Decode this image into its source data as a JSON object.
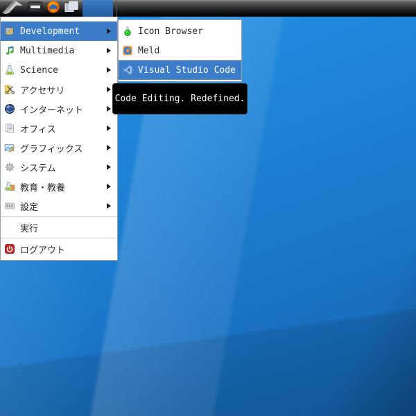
{
  "panel": {
    "buttons": [
      {
        "icon": "app-menu-logo-icon"
      },
      {
        "icon": "file-manager-icon"
      },
      {
        "icon": "firefox-icon"
      },
      {
        "icon": "window-pager-icon"
      },
      {
        "icon": "active-task-button",
        "active": true,
        "color": "#2a65ad"
      }
    ]
  },
  "menu": {
    "items": [
      {
        "label": "Development",
        "icon": "development-icon",
        "has_submenu": true,
        "highlighted": true
      },
      {
        "label": "Multimedia",
        "icon": "multimedia-icon",
        "has_submenu": true,
        "highlighted": false
      },
      {
        "label": "Science",
        "icon": "science-icon",
        "has_submenu": true,
        "highlighted": false
      },
      {
        "label": "アクセサリ",
        "icon": "accessories-icon",
        "has_submenu": true,
        "highlighted": false
      },
      {
        "label": "インターネット",
        "icon": "internet-icon",
        "has_submenu": true,
        "highlighted": false
      },
      {
        "label": "オフィス",
        "icon": "office-icon",
        "has_submenu": true,
        "highlighted": false
      },
      {
        "label": "グラフィックス",
        "icon": "graphics-icon",
        "has_submenu": true,
        "highlighted": false
      },
      {
        "label": "システム",
        "icon": "system-icon",
        "has_submenu": true,
        "highlighted": false
      },
      {
        "label": "教育・教養",
        "icon": "education-icon",
        "has_submenu": true,
        "highlighted": false
      },
      {
        "label": "設定",
        "icon": "settings-icon",
        "has_submenu": true,
        "highlighted": false
      },
      {
        "label": "実行",
        "icon": null,
        "has_submenu": false,
        "highlighted": false
      },
      {
        "label": "ログアウト",
        "icon": "logout-icon",
        "has_submenu": false,
        "highlighted": false
      }
    ]
  },
  "submenu": {
    "items": [
      {
        "label": "Icon Browser",
        "icon": "icon-browser-icon",
        "highlighted": false
      },
      {
        "label": "Meld",
        "icon": "meld-icon",
        "highlighted": false
      },
      {
        "label": "Visual Studio Code",
        "icon": "vscode-icon",
        "highlighted": true
      }
    ]
  },
  "tooltip": {
    "text": "Code Editing. Redefined."
  },
  "colors": {
    "menu_highlight": "#3c7cc9",
    "menu_bg": "#ffffff",
    "menu_text": "#2a2a2a",
    "highlight_text": "#ffffff",
    "tooltip_bg": "#000000",
    "tooltip_text": "#ffffff",
    "panel_task_blue": "#2a65ad",
    "wallpaper_top": "#2d9ae8",
    "wallpaper_bottom": "#1464b0"
  }
}
